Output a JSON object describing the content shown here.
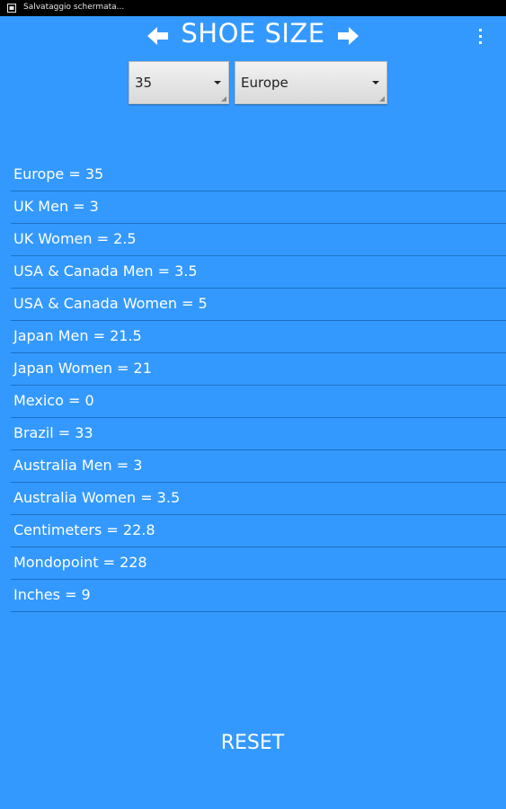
{
  "status_bar": {
    "notification_text": "Salvataggio schermata..."
  },
  "header": {
    "title": "SHOE SIZE",
    "prev_icon": "arrow-left-icon",
    "next_icon": "arrow-right-icon",
    "menu_icon": "overflow-menu-icon"
  },
  "selectors": {
    "size_value": "35",
    "region_value": "Europe"
  },
  "results": [
    "Europe = 35",
    "UK Men = 3",
    "UK Women = 2.5",
    "USA & Canada Men = 3.5",
    "USA & Canada Women = 5",
    "Japan Men = 21.5",
    "Japan Women = 21",
    "Mexico = 0",
    "Brazil = 33",
    "Australia Men = 3",
    "Australia Women = 3.5",
    "Centimeters = 22.8",
    "Mondopoint = 228",
    "Inches = 9"
  ],
  "actions": {
    "reset_label": "RESET"
  },
  "colors": {
    "background": "#3399ff",
    "status_bar": "#000000",
    "divider": "#1f6fc4",
    "text": "#ffffff"
  }
}
